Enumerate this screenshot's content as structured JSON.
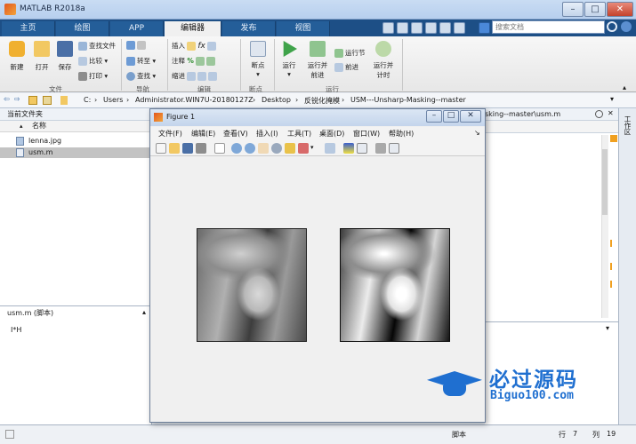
{
  "window": {
    "title": "MATLAB R2018a",
    "min": "–",
    "max": "□",
    "close": "✕"
  },
  "tabs": [
    {
      "label": "主页"
    },
    {
      "label": "绘图"
    },
    {
      "label": "APP"
    },
    {
      "label": "编辑器"
    },
    {
      "label": "发布"
    },
    {
      "label": "视图"
    }
  ],
  "search": {
    "placeholder": "搜索文档"
  },
  "ribbon": {
    "file": {
      "new": "新建",
      "open": "打开",
      "save": "保存",
      "find_file": "查找文件",
      "compare": "比较",
      "print": "打印",
      "group": "文件"
    },
    "nav": {
      "goto": "转至",
      "find": "查找",
      "group": "导航"
    },
    "edit": {
      "insert": "插入",
      "fx": "fx",
      "comment": "注释",
      "indent": "缩进",
      "group": "编辑"
    },
    "breakpoint": {
      "label": "断点",
      "group": "断点"
    },
    "run": {
      "run": "运行",
      "run_advance_1": "运行并",
      "run_advance_2": "前进",
      "run_section": "运行节",
      "advance": "前进",
      "run_time_1": "运行并",
      "run_time_2": "计时",
      "group": "运行"
    }
  },
  "address": {
    "path": [
      "C:",
      "Users",
      "Administrator.WIN7U-20180127Z",
      "Desktop",
      "反锐化掩模",
      "USM---Unsharp-Masking--master"
    ]
  },
  "current_folder": {
    "title": "当前文件夹",
    "column": "名称",
    "files": [
      {
        "name": "lenna.jpg"
      },
      {
        "name": "usm.m"
      }
    ]
  },
  "details": {
    "title": "usm.m (脚本)",
    "content": "I*H"
  },
  "editor_tab": {
    "label": "sking--master\\usm.m"
  },
  "workspace_strip": {
    "label": "工作区"
  },
  "status": {
    "mode": "脚本",
    "row_label": "行",
    "row": "7",
    "col_label": "列",
    "col": "19"
  },
  "figure": {
    "title": "Figure 1",
    "menu": [
      "文件(F)",
      "编辑(E)",
      "查看(V)",
      "插入(I)",
      "工具(T)",
      "桌面(D)",
      "窗口(W)",
      "帮助(H)"
    ]
  },
  "watermark": {
    "brand": "必过源码",
    "site": "Biguo100.com"
  },
  "colors": {
    "accent": "#1d4f86",
    "ribbon_bg": "#ececec",
    "watermark": "#1f6fd0"
  }
}
